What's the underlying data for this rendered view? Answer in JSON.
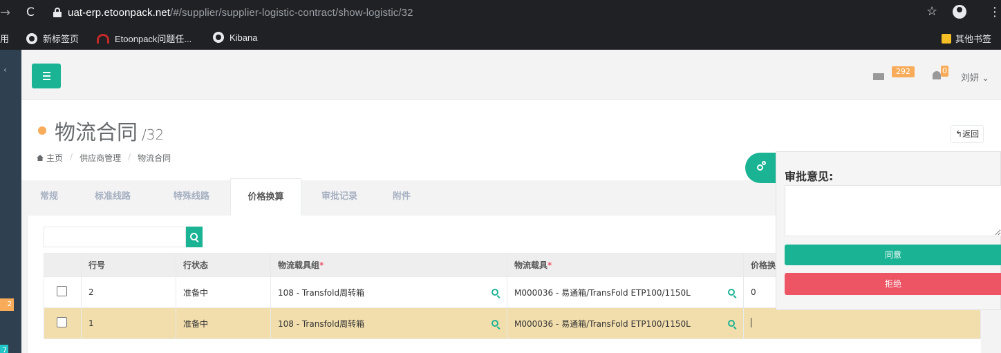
{
  "browser": {
    "url_host": "uat-erp.etoonpack.net",
    "url_path": "/#/supplier/supplier-logistic-contract/show-logistic/32",
    "bookmarks": {
      "apps_label": "用",
      "items": [
        "新标签页",
        "Etoonpack问题任...",
        "Kibana"
      ],
      "other": "其他书签"
    }
  },
  "sidebar": {
    "badges": [
      "2",
      "7"
    ]
  },
  "header": {
    "mail_count": "292",
    "alert_count": "0",
    "user": "刘妍"
  },
  "page": {
    "title": "物流合同",
    "id": "/32",
    "breadcrumb": [
      "主页",
      "供应商管理",
      "物流合同"
    ],
    "back_label": "返回"
  },
  "tabs": [
    "常规",
    "标准线路",
    "特殊线路",
    "价格换算",
    "审批记录",
    "附件"
  ],
  "table": {
    "columns": [
      "行号",
      "行状态",
      "物流载具组",
      "物流载具",
      "价格换"
    ],
    "rows": [
      {
        "line": "2",
        "status": "准备中",
        "group": "108 - Transfold周转箱",
        "carrier": "M000036 - 易通箱/TransFold ETP100/1150L",
        "price": "0"
      },
      {
        "line": "1",
        "status": "准备中",
        "group": "108 - Transfold周转箱",
        "carrier": "M000036 - 易通箱/TransFold ETP100/1150L",
        "price": ""
      }
    ]
  },
  "approval": {
    "title": "审批意见:",
    "agree": "同意",
    "reject": "拒绝"
  },
  "colors": {
    "accent": "#1ab394",
    "danger": "#ed5565",
    "warning": "#f8ac59",
    "selected_row": "#f2dead"
  }
}
